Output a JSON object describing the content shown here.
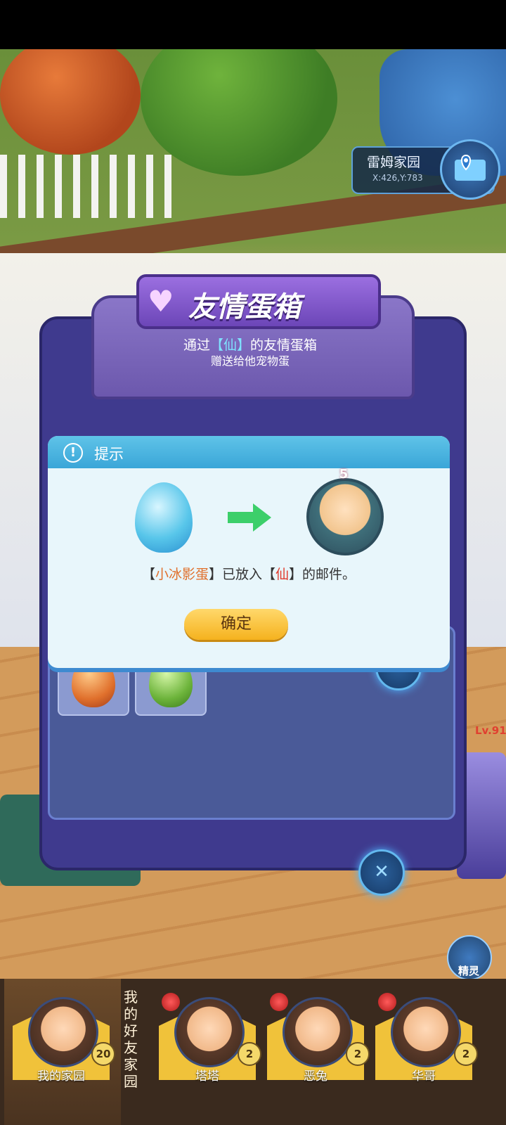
{
  "location": {
    "name": "雷姆家园",
    "coord": "X:426,Y:783"
  },
  "egg_box": {
    "title": "友情蛋箱",
    "desc_prefix": "通过",
    "desc_user": "【仙】",
    "desc_suffix": "的友情蛋箱",
    "desc_line2": "赠送给他宠物蛋"
  },
  "dialog": {
    "title": "提示",
    "avatar_level": "5",
    "msg_open1": "【",
    "msg_egg": "小冰影蛋",
    "msg_close1": "】已放入【",
    "msg_user": "仙",
    "msg_close2": "】的邮件。",
    "confirm_label": "确定"
  },
  "side": {
    "level_text": "Lv.91",
    "sprite_label": "精灵"
  },
  "friend_bar": {
    "my_home": {
      "name": "我的家园",
      "count": "20"
    },
    "friends_label": "我的好友家园",
    "friends": [
      {
        "name": "塔塔",
        "count": "2"
      },
      {
        "name": "恶兔",
        "count": "2"
      },
      {
        "name": "华哥",
        "count": "2"
      }
    ]
  },
  "colors": {
    "accent": "#3aa6d8",
    "confirm": "#f5b21e",
    "egg_name": "#e0702c",
    "user_name": "#e03a2c"
  }
}
